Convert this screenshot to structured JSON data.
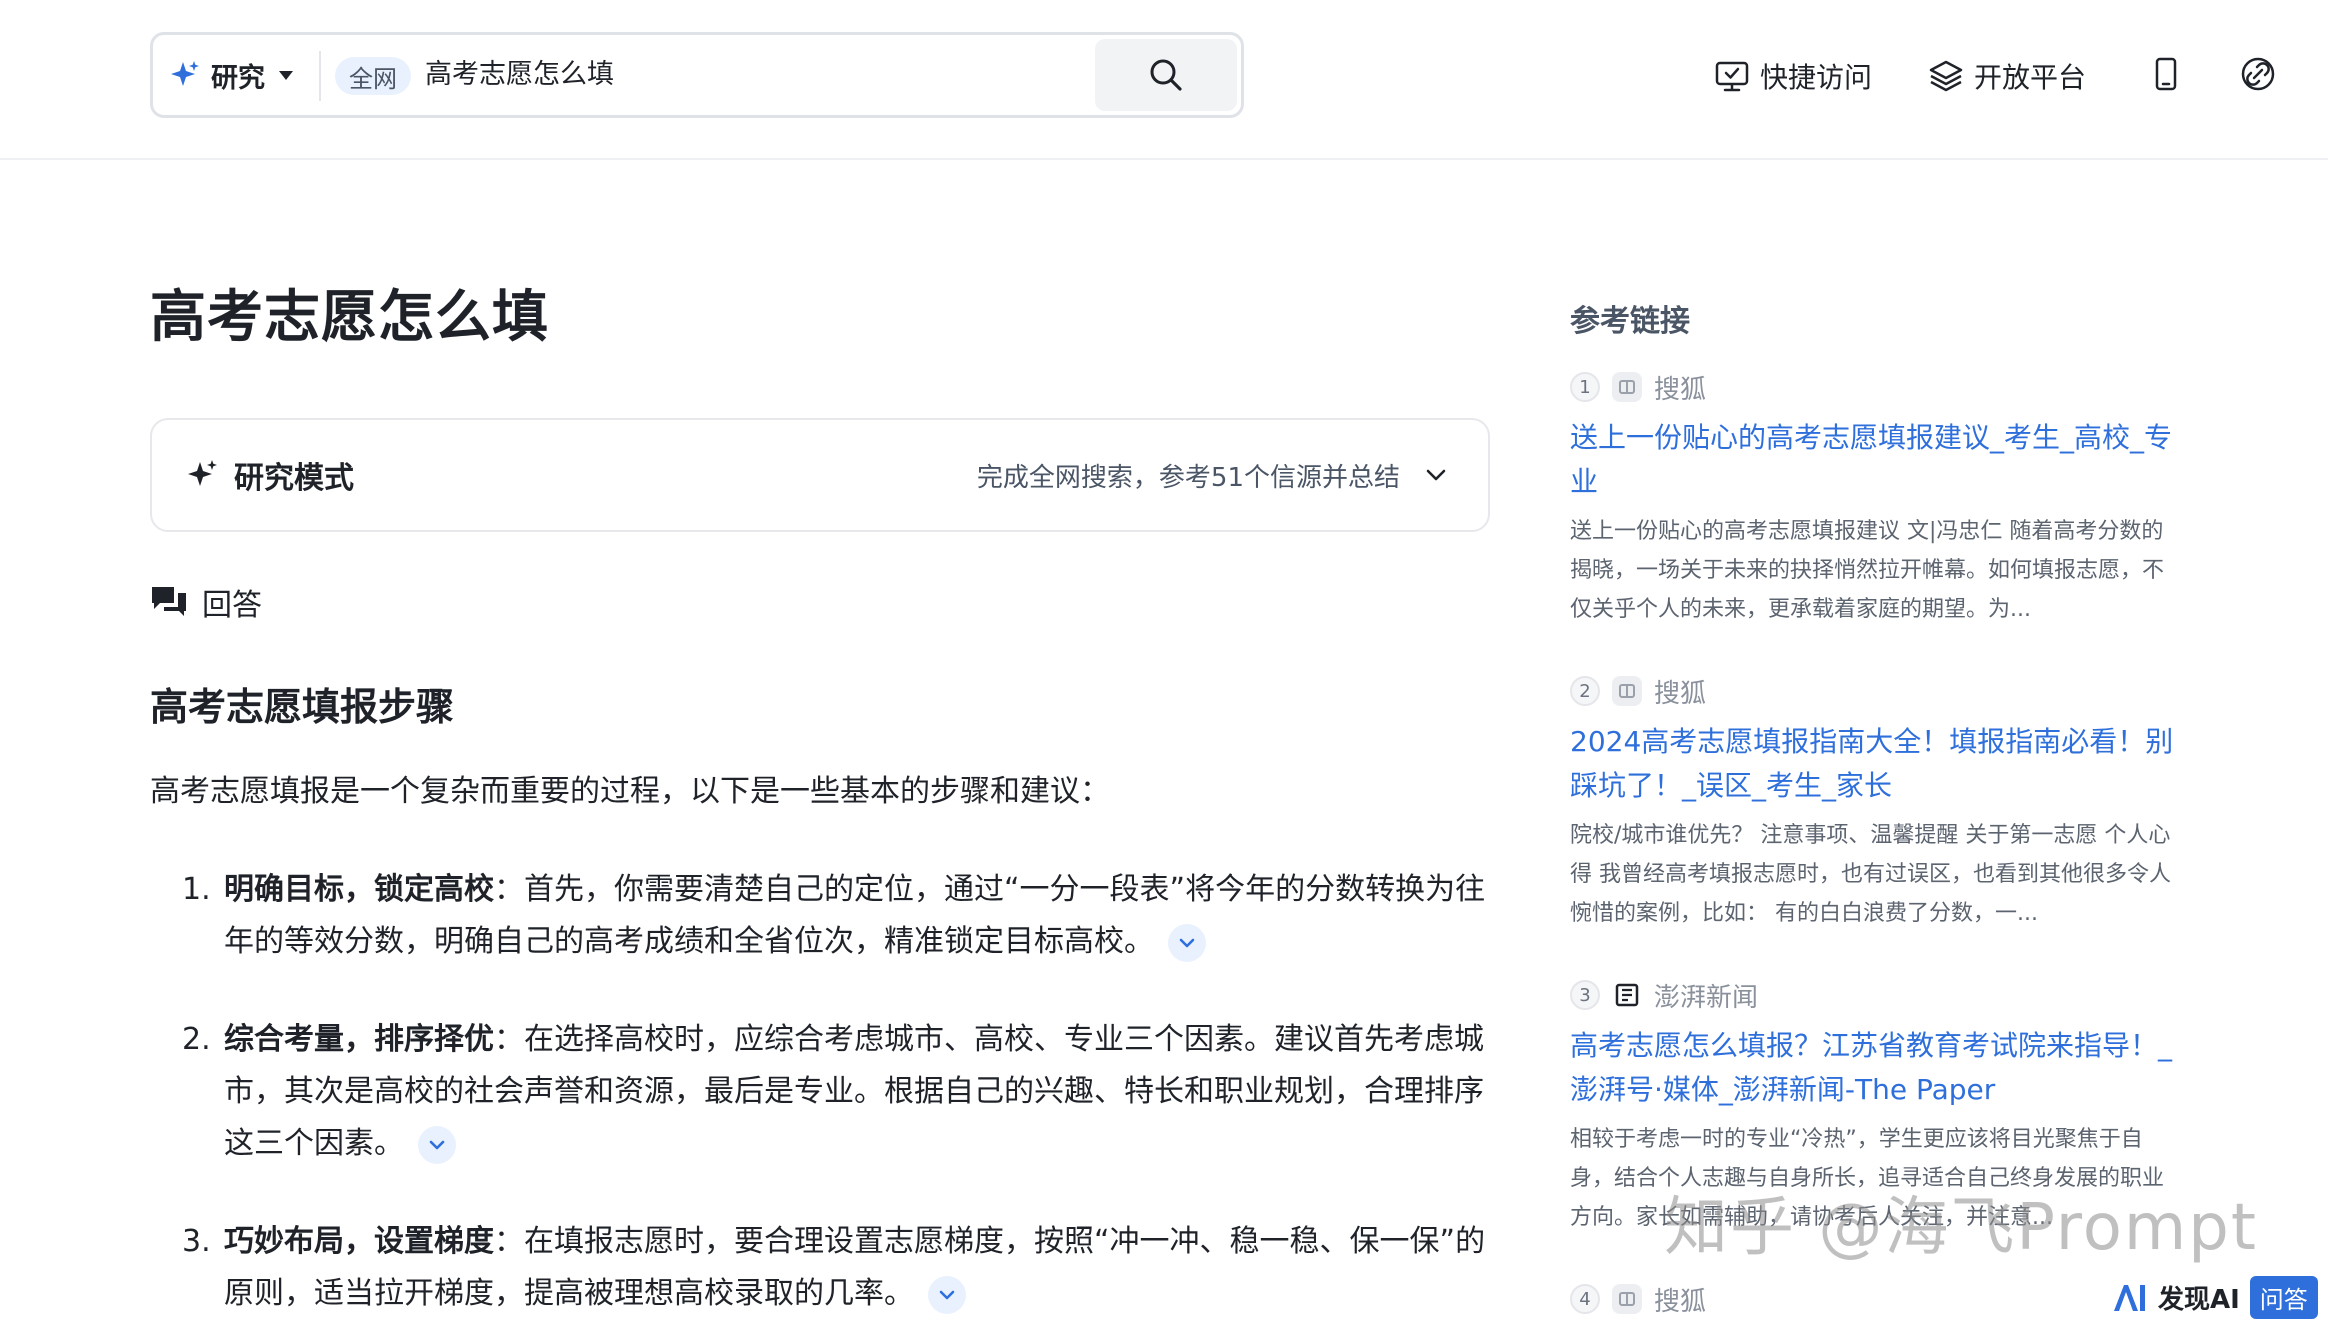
{
  "header": {
    "mode_label": "研究",
    "scope_tag": "全网",
    "search_query": "高考志愿怎么填",
    "quick_access": "快捷访问",
    "open_platform": "开放平台"
  },
  "main": {
    "title": "高考志愿怎么填",
    "research_mode": {
      "label": "研究模式",
      "summary": "完成全网搜索，参考51个信源并总结"
    },
    "answer_label": "回答",
    "section_heading": "高考志愿填报步骤",
    "intro": "高考志愿填报是一个复杂而重要的过程，以下是一些基本的步骤和建议：",
    "steps": [
      {
        "num": "1.",
        "title": "明确目标，锁定高校",
        "text": "：首先，你需要清楚自己的定位，通过“一分一段表”将今年的分数转换为往年的等效分数，明确自己的高考成绩和全省位次，精准锁定目标高校。"
      },
      {
        "num": "2.",
        "title": "综合考量，排序择优",
        "text": "：在选择高校时，应综合考虑城市、高校、专业三个因素。建议首先考虑城市，其次是高校的社会声誉和资源，最后是专业。根据自己的兴趣、特长和职业规划，合理排序这三个因素。"
      },
      {
        "num": "3.",
        "title": "巧妙布局，设置梯度",
        "text": "：在填报志愿时，要合理设置志愿梯度，按照“冲一冲、稳一稳、保一保”的原则，适当拉开梯度，提高被理想高校录取的几率。"
      }
    ]
  },
  "sidebar": {
    "title": "参考链接",
    "refs": [
      {
        "num": "1",
        "source": "搜狐",
        "title": "送上一份贴心的高考志愿填报建议_考生_高校_专业",
        "snippet": "送上一份贴心的高考志愿填报建议 文|冯忠仁 随着高考分数的揭晓，一场关于未来的抉择悄然拉开帷幕。如何填报志愿，不仅关乎个人的未来，更承载着家庭的期望。为..."
      },
      {
        "num": "2",
        "source": "搜狐",
        "title": "2024高考志愿填报指南大全！填报指南必看！别踩坑了！_误区_考生_家长",
        "snippet": "院校/城市谁优先？ 注意事项、温馨提醒 关于第一志愿 个人心得 我曾经高考填报志愿时，也有过误区，也看到其他很多令人惋惜的案例，比如： 有的白白浪费了分数，一..."
      },
      {
        "num": "3",
        "source": "澎湃新闻",
        "title": "高考志愿怎么填报？江苏省教育考试院来指导！_澎湃号·媒体_澎湃新闻-The Paper",
        "snippet": "相较于考虑一时的专业“冷热”，学生更应该将目光聚焦于自身，结合个人志趣与自身所长，追寻适合自己终身发展的职业方向。家长如需辅助，请协考后人关注，并注意..."
      },
      {
        "num": "4",
        "source": "搜狐",
        "title": "",
        "snippet": ""
      }
    ]
  },
  "overlay": {
    "watermark": "知乎 @海飞Prompt",
    "badge_brand": "发现AI",
    "badge_qa": "问答"
  },
  "colors": {
    "accent": "#2e6fdb",
    "spark": "#2e6fdb",
    "text": "#1f2329",
    "muted": "#5c6470"
  }
}
